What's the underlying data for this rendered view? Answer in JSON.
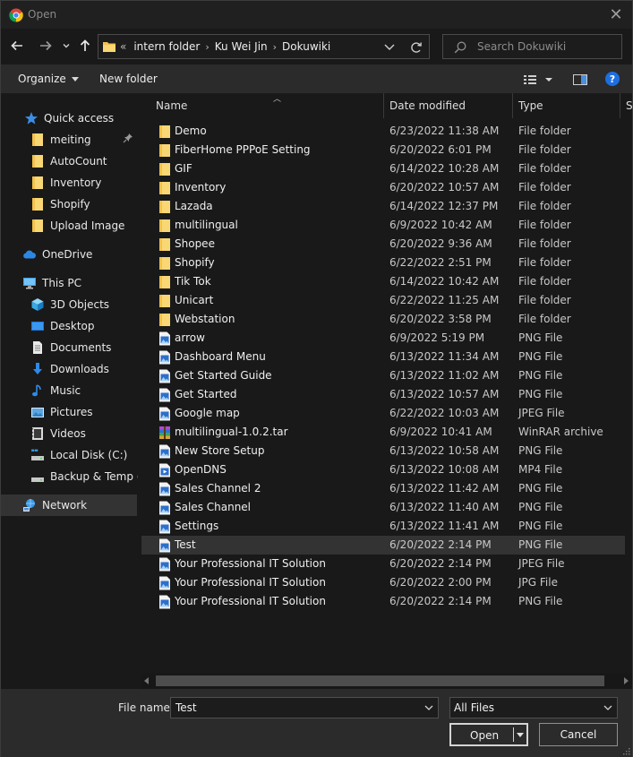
{
  "window": {
    "title": "Open",
    "close_glyph": "✕"
  },
  "nav": {
    "back": "back-arrow-icon",
    "forward": "forward-arrow-icon",
    "recent": "chevron-down-icon",
    "up": "up-arrow-icon",
    "breadcrumb_overflow": "«",
    "breadcrumbs": [
      "intern folder",
      "Ku Wei Jin",
      "Dokuwiki"
    ],
    "search_placeholder": "Search Dokuwiki"
  },
  "toolbar": {
    "organize_label": "Organize",
    "new_folder_label": "New folder",
    "help_label": "?"
  },
  "sidebar": {
    "items": [
      {
        "label": "Quick access",
        "icon": "star-icon"
      },
      {
        "label": "meiting",
        "icon": "folder-icon",
        "pinned": true
      },
      {
        "label": "AutoCount",
        "icon": "folder-icon"
      },
      {
        "label": "Inventory",
        "icon": "folder-icon"
      },
      {
        "label": "Shopify",
        "icon": "folder-icon"
      },
      {
        "label": "Upload Image",
        "icon": "folder-icon"
      },
      {
        "label": "OneDrive",
        "icon": "cloud-icon"
      },
      {
        "label": "This PC",
        "icon": "monitor-icon"
      },
      {
        "label": "3D Objects",
        "icon": "cube-icon"
      },
      {
        "label": "Desktop",
        "icon": "desktop-icon"
      },
      {
        "label": "Documents",
        "icon": "document-icon"
      },
      {
        "label": "Downloads",
        "icon": "download-icon"
      },
      {
        "label": "Music",
        "icon": "music-icon"
      },
      {
        "label": "Pictures",
        "icon": "pictures-icon"
      },
      {
        "label": "Videos",
        "icon": "video-icon"
      },
      {
        "label": "Local Disk (C:)",
        "icon": "drive-icon"
      },
      {
        "label": "Backup & Temp (D",
        "icon": "drive-icon"
      },
      {
        "label": "Network",
        "icon": "network-icon",
        "selected": true
      }
    ]
  },
  "columns": {
    "name": "Name",
    "date": "Date modified",
    "type": "Type",
    "size": "Si"
  },
  "files": [
    {
      "name": "Demo",
      "date": "6/23/2022 11:38 AM",
      "type": "File folder",
      "icon": "folder"
    },
    {
      "name": "FiberHome PPPoE Setting",
      "date": "6/20/2022 6:01 PM",
      "type": "File folder",
      "icon": "folder"
    },
    {
      "name": "GIF",
      "date": "6/14/2022 10:28 AM",
      "type": "File folder",
      "icon": "folder"
    },
    {
      "name": "Inventory",
      "date": "6/20/2022 10:57 AM",
      "type": "File folder",
      "icon": "folder"
    },
    {
      "name": "Lazada",
      "date": "6/14/2022 12:37 PM",
      "type": "File folder",
      "icon": "folder"
    },
    {
      "name": "multilingual",
      "date": "6/9/2022 10:42 AM",
      "type": "File folder",
      "icon": "folder"
    },
    {
      "name": "Shopee",
      "date": "6/20/2022 9:36 AM",
      "type": "File folder",
      "icon": "folder"
    },
    {
      "name": "Shopify",
      "date": "6/22/2022 2:51 PM",
      "type": "File folder",
      "icon": "folder"
    },
    {
      "name": "Tik Tok",
      "date": "6/14/2022 10:42 AM",
      "type": "File folder",
      "icon": "folder"
    },
    {
      "name": "Unicart",
      "date": "6/22/2022 11:25 AM",
      "type": "File folder",
      "icon": "folder"
    },
    {
      "name": "Webstation",
      "date": "6/20/2022 3:58 PM",
      "type": "File folder",
      "icon": "folder"
    },
    {
      "name": "arrow",
      "date": "6/9/2022 5:19 PM",
      "type": "PNG File",
      "icon": "image"
    },
    {
      "name": "Dashboard Menu",
      "date": "6/13/2022 11:34 AM",
      "type": "PNG File",
      "icon": "image"
    },
    {
      "name": "Get Started Guide",
      "date": "6/13/2022 11:02 AM",
      "type": "PNG File",
      "icon": "image"
    },
    {
      "name": "Get Started",
      "date": "6/13/2022 10:57 AM",
      "type": "PNG File",
      "icon": "image"
    },
    {
      "name": "Google map",
      "date": "6/22/2022 10:03 AM",
      "type": "JPEG File",
      "icon": "image"
    },
    {
      "name": "multilingual-1.0.2.tar",
      "date": "6/9/2022 10:41 AM",
      "type": "WinRAR archive",
      "icon": "archive"
    },
    {
      "name": "New Store Setup",
      "date": "6/13/2022 10:58 AM",
      "type": "PNG File",
      "icon": "image"
    },
    {
      "name": "OpenDNS",
      "date": "6/13/2022 10:08 AM",
      "type": "MP4 File",
      "icon": "video"
    },
    {
      "name": "Sales Channel 2",
      "date": "6/13/2022 11:42 AM",
      "type": "PNG File",
      "icon": "image"
    },
    {
      "name": "Sales Channel",
      "date": "6/13/2022 11:40 AM",
      "type": "PNG File",
      "icon": "image"
    },
    {
      "name": "Settings",
      "date": "6/13/2022 11:41 AM",
      "type": "PNG File",
      "icon": "image"
    },
    {
      "name": "Test",
      "date": "6/20/2022 2:14 PM",
      "type": "PNG File",
      "icon": "image",
      "selected": true
    },
    {
      "name": "Your Professional IT Solution",
      "date": "6/20/2022 2:14 PM",
      "type": "JPEG File",
      "icon": "image"
    },
    {
      "name": "Your Professional IT Solution",
      "date": "6/20/2022 2:00 PM",
      "type": "JPG File",
      "icon": "image"
    },
    {
      "name": "Your Professional IT Solution",
      "date": "6/20/2022 2:14 PM",
      "type": "PNG File",
      "icon": "image"
    }
  ],
  "bottom": {
    "file_name_label": "File name:",
    "file_name_value": "Test",
    "file_type_value": "All Files",
    "open_label": "Open",
    "cancel_label": "Cancel"
  },
  "colors": {
    "background": "#191919",
    "toolbar": "#2b2b2b",
    "selection": "#333333",
    "folder": "#f3c14b",
    "accent_blue": "#1d6fe0"
  }
}
